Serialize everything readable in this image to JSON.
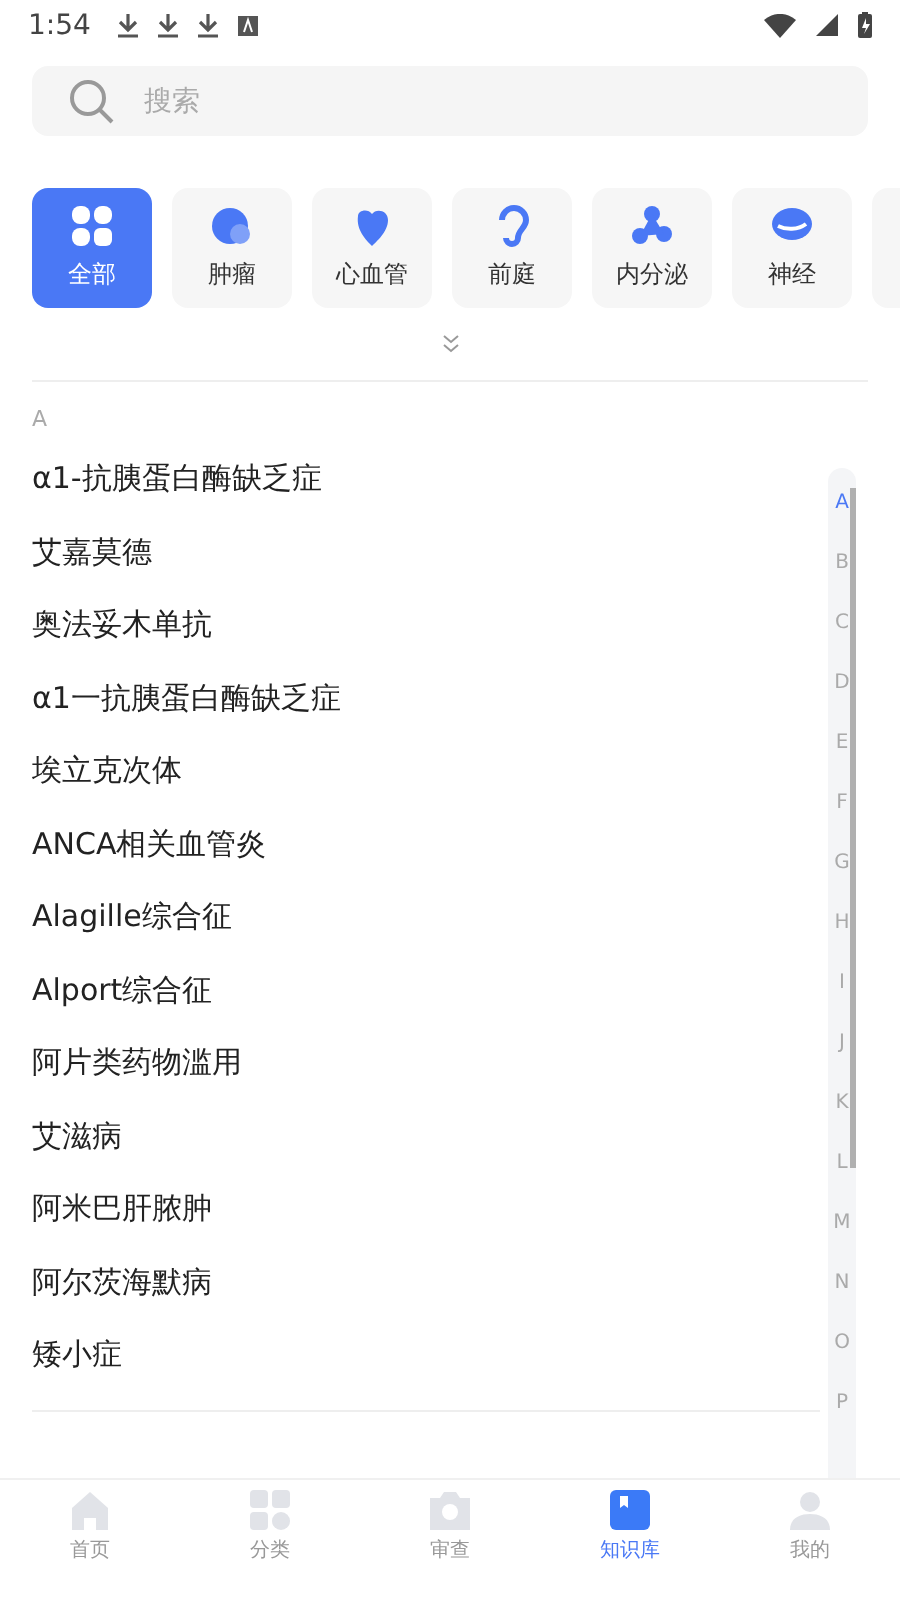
{
  "status_bar": {
    "time": "1:54"
  },
  "search": {
    "placeholder": "搜索"
  },
  "categories": [
    {
      "label": "全部",
      "kind": "all",
      "selected": true
    },
    {
      "label": "肿瘤",
      "kind": "tumor",
      "selected": false
    },
    {
      "label": "心血管",
      "kind": "heart",
      "selected": false
    },
    {
      "label": "前庭",
      "kind": "ear",
      "selected": false
    },
    {
      "label": "内分泌",
      "kind": "endocrine",
      "selected": false
    },
    {
      "label": "神经",
      "kind": "brain",
      "selected": false
    }
  ],
  "section": {
    "letter": "A",
    "items": [
      "α1-抗胰蛋白酶缺乏症",
      "艾嘉莫德",
      "奥法妥木单抗",
      "α1一抗胰蛋白酶缺乏症",
      "埃立克次体",
      "ANCA相关血管炎",
      "Alagille综合征",
      "Alport综合征",
      "阿片类药物滥用",
      "艾滋病",
      "阿米巴肝脓肿",
      "阿尔茨海默病",
      "矮小症"
    ]
  },
  "index": [
    {
      "letter": "A",
      "selected": true
    },
    {
      "letter": "B",
      "selected": false
    },
    {
      "letter": "C",
      "selected": false
    },
    {
      "letter": "D",
      "selected": false
    },
    {
      "letter": "E",
      "selected": false
    },
    {
      "letter": "F",
      "selected": false
    },
    {
      "letter": "G",
      "selected": false
    },
    {
      "letter": "H",
      "selected": false
    },
    {
      "letter": "I",
      "selected": false
    },
    {
      "letter": "J",
      "selected": false
    },
    {
      "letter": "K",
      "selected": false
    },
    {
      "letter": "L",
      "selected": false
    },
    {
      "letter": "M",
      "selected": false
    },
    {
      "letter": "N",
      "selected": false
    },
    {
      "letter": "O",
      "selected": false
    },
    {
      "letter": "P",
      "selected": false
    }
  ],
  "nav": [
    {
      "label": "首页",
      "kind": "home",
      "selected": false
    },
    {
      "label": "分类",
      "kind": "grid",
      "selected": false
    },
    {
      "label": "审查",
      "kind": "camera",
      "selected": false
    },
    {
      "label": "知识库",
      "kind": "book",
      "selected": true
    },
    {
      "label": "我的",
      "kind": "person",
      "selected": false
    }
  ]
}
